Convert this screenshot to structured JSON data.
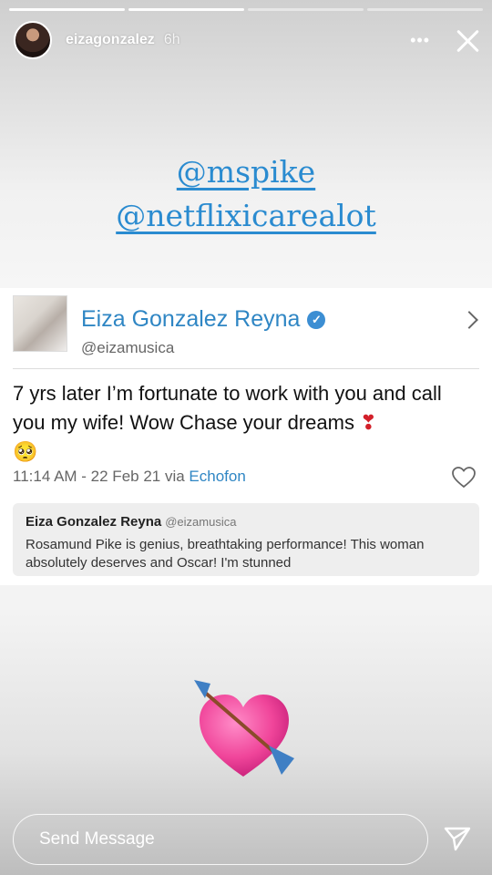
{
  "story": {
    "username": "eizagonzalez",
    "time": "6h",
    "more_label": "•••",
    "progress": [
      1,
      1,
      0,
      0
    ]
  },
  "mentions": [
    "@mspike",
    "@netflixicarealot"
  ],
  "tweet": {
    "display_name": "Eiza Gonzalez Reyna",
    "handle": "@eizamusica",
    "text_main": "7 yrs later I’m fortunate to work with you and call you my wife! Wow Chase your dreams ",
    "text_emoji_heart": "❣",
    "text_emoji_face": "🥺",
    "timestamp": "11:14 AM - 22 Feb 21 via ",
    "via": "Echofon"
  },
  "quoted_tweet": {
    "display_name": "Eiza Gonzalez Reyna",
    "handle": "@eizamusica",
    "text": "Rosamund Pike is genius, breathtaking performance! This woman absolutely deserves and Oscar! I'm stunned"
  },
  "composer": {
    "placeholder": "Send Message"
  },
  "colors": {
    "link": "#2a8bd0",
    "verified": "#3c8ed3",
    "heart_sticker": "#f0459a"
  }
}
